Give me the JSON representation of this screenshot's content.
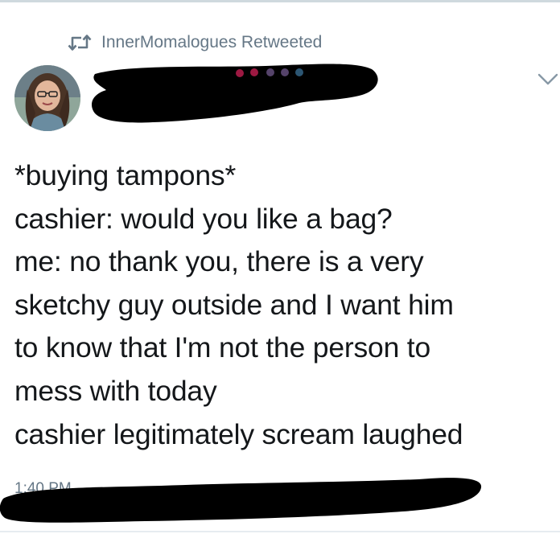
{
  "retweet": {
    "icon": "retweet-icon",
    "label": "InnerMomalogues Retweeted"
  },
  "author": {
    "avatar": "avatar",
    "name_redacted": true
  },
  "menu": {
    "icon": "chevron-down-icon"
  },
  "tweet": {
    "lines": [
      "*buying tampons*",
      "cashier: would you like a bag?",
      "me: no thank you, there is a very",
      "sketchy guy outside and I want him",
      "to know that I'm not the person to",
      "mess with today",
      "cashier legitimately scream laughed"
    ]
  },
  "timestamp": {
    "text": "1:40 PM"
  },
  "colors": {
    "text": "#14171a",
    "secondary": "#657786",
    "redaction": "#000000"
  }
}
